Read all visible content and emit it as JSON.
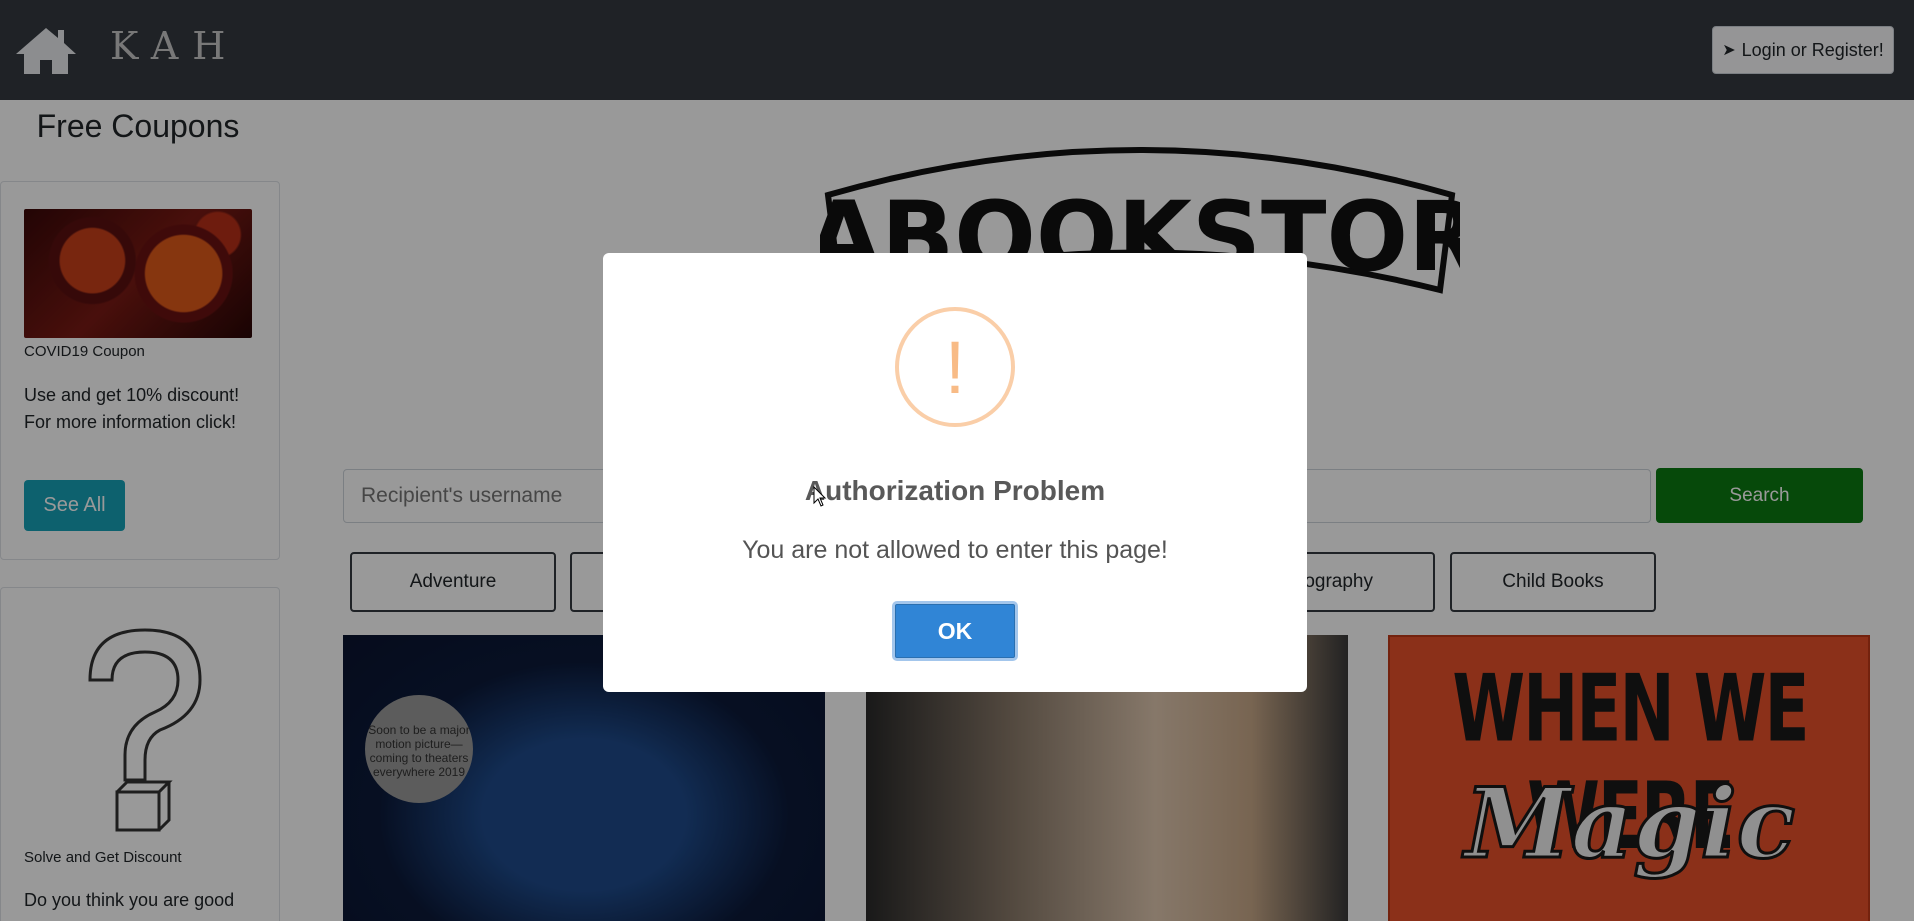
{
  "navbar": {
    "brand": "KAH",
    "login_label": "Login or Register!",
    "icons": [
      "home-icon",
      "sign-in-icon"
    ]
  },
  "sidebar": {
    "title": "Free Coupons",
    "coupon": {
      "caption": "COVID19 Coupon",
      "text": "Use and get 10% discount! For more information click!",
      "button_label": "See All"
    },
    "puzzle": {
      "caption": "Solve and Get Discount",
      "text": "Do you think you are good"
    }
  },
  "main": {
    "logo_text": "KABOOKSTORE",
    "search": {
      "placeholder": "Recipient's username",
      "button_label": "Search"
    },
    "categories": [
      "Adventure",
      "",
      "",
      "ography",
      "Child Books"
    ],
    "books": [
      {
        "badge": "Soon to be a major motion picture—coming to theaters everywhere 2019"
      },
      {
        "badge": ""
      },
      {
        "title_line1": "WHEN WE WERE",
        "title_line2": "Magic"
      }
    ]
  },
  "modal": {
    "title": "Authorization Problem",
    "text": "You are not allowed to enter this page!",
    "ok_label": "OK",
    "icon_glyph": "!",
    "colors": {
      "warning": "#f8bb86",
      "confirm": "#3085d6"
    }
  },
  "colors": {
    "navbar": "#343a40",
    "search_button": "#0b7a12",
    "see_all_button": "#17a2b8"
  }
}
